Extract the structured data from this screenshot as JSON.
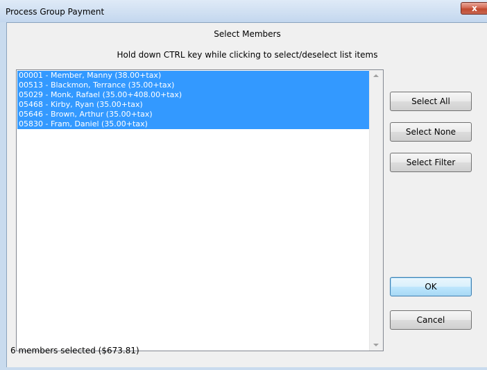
{
  "window": {
    "title": "Process Group Payment",
    "close_symbol": "x"
  },
  "dialog": {
    "heading": "Select Members",
    "instruction": "Hold down CTRL key while clicking to select/deselect list items"
  },
  "members": [
    {
      "label": "00001 - Member, Manny (38.00+tax)",
      "selected": true
    },
    {
      "label": "00513 - Blackmon, Terrance (35.00+tax)",
      "selected": true
    },
    {
      "label": "05029 - Monk, Rafael (35.00+408.00+tax)",
      "selected": true
    },
    {
      "label": "05468 - Kirby, Ryan (35.00+tax)",
      "selected": true
    },
    {
      "label": "05646 - Brown, Arthur (35.00+tax)",
      "selected": true
    },
    {
      "label": "05830 - Fram, Daniel (35.00+tax)",
      "selected": true
    }
  ],
  "buttons": {
    "select_all": "Select All",
    "select_none": "Select None",
    "select_filter": "Select Filter",
    "ok": "OK",
    "cancel": "Cancel"
  },
  "status": {
    "summary": "6 members selected ($673.81)"
  },
  "colors": {
    "selection": "#3399ff",
    "selection_text": "#ffffff",
    "dialog_bg": "#f0f0f0",
    "titlebar": "#c9dbee"
  }
}
